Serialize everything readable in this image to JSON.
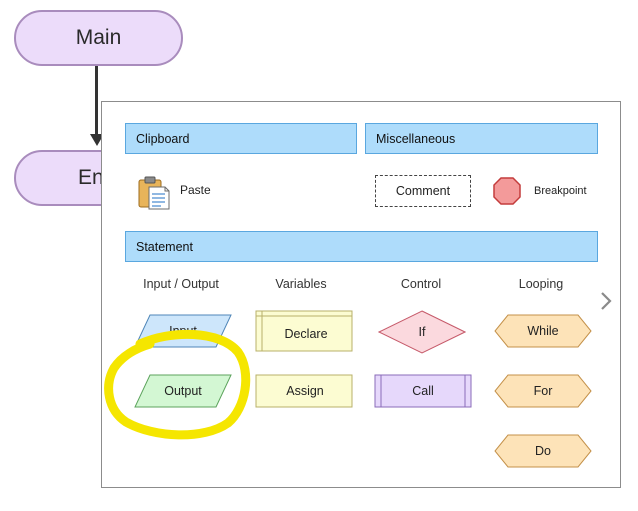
{
  "flowchart": {
    "main_label": "Main",
    "end_label": "End"
  },
  "popup": {
    "clipboard_header": "Clipboard",
    "misc_header": "Miscellaneous",
    "statement_header": "Statement",
    "paste_label": "Paste",
    "comment_label": "Comment",
    "breakpoint_label": "Breakpoint",
    "columns": {
      "io": "Input / Output",
      "variables": "Variables",
      "control": "Control",
      "looping": "Looping"
    },
    "shapes": {
      "input": "Input",
      "output": "Output",
      "declare": "Declare",
      "assign": "Assign",
      "if": "If",
      "call": "Call",
      "while": "While",
      "for": "For",
      "do": "Do"
    }
  },
  "colors": {
    "terminal_fill": "#ecdcfa",
    "header_fill": "#aedcfb",
    "input_fill": "#cde6fb",
    "output_fill": "#d3f7d3",
    "variables_fill": "#fcfcd2",
    "if_fill": "#fbd9de",
    "call_fill": "#e6d8fb",
    "looping_fill": "#fde3b8",
    "highlight": "#f5e600"
  },
  "icons": {
    "paste": "clipboard-icon",
    "breakpoint": "octagon-icon",
    "next": "chevron-right-icon"
  }
}
